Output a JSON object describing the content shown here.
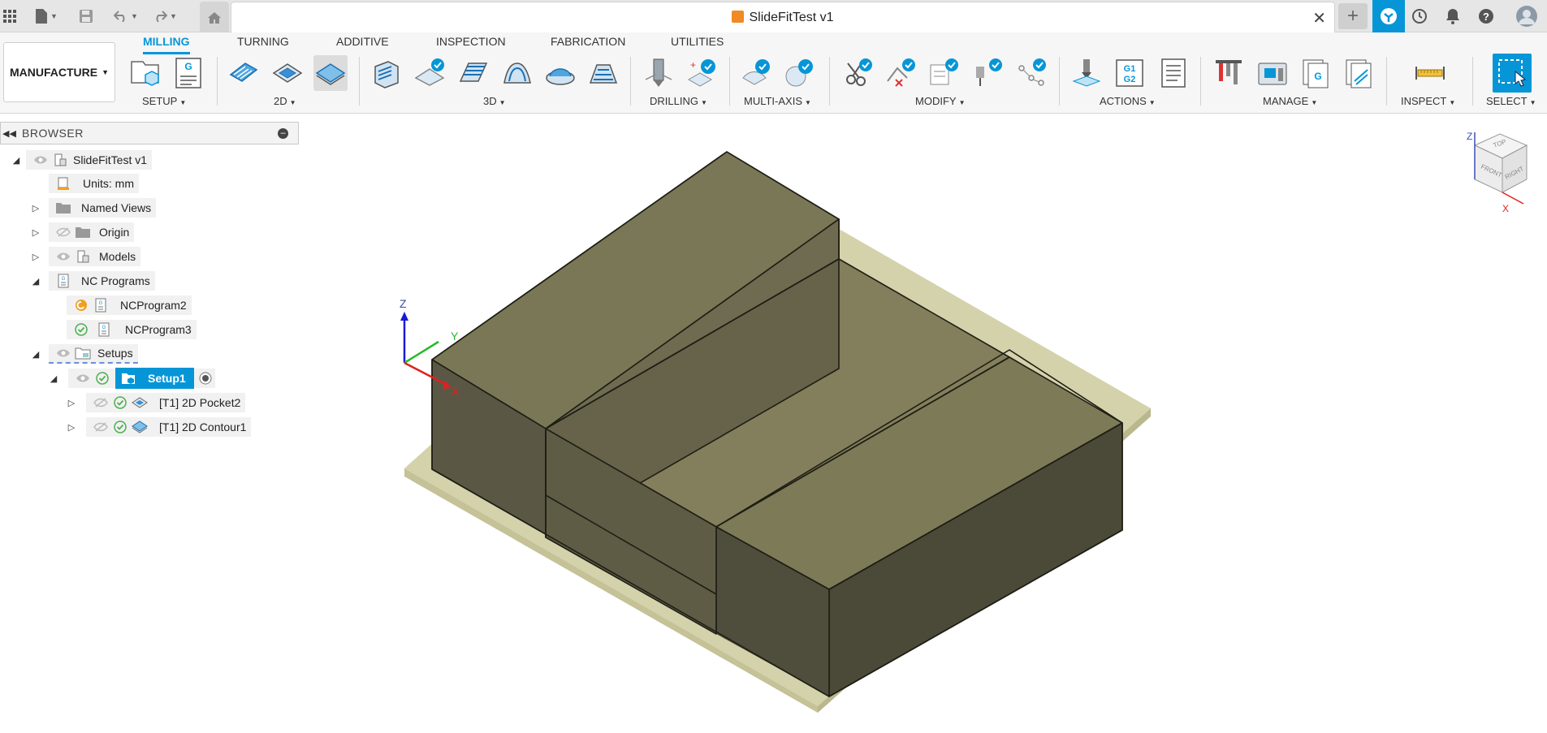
{
  "titlebar": {
    "document_title": "SlideFitTest v1",
    "icons": [
      "app-grid-icon",
      "file-icon",
      "save-icon",
      "undo-icon",
      "redo-icon",
      "home-icon",
      "close-icon",
      "plus-icon",
      "job-status-icon",
      "clock-icon",
      "bell-icon",
      "help-icon",
      "user-avatar-icon"
    ]
  },
  "toolbar": {
    "workspace": "MANUFACTURE",
    "tabs": [
      "MILLING",
      "TURNING",
      "ADDITIVE",
      "INSPECTION",
      "FABRICATION",
      "UTILITIES"
    ],
    "active_tab": "MILLING",
    "groups": [
      "SETUP",
      "2D",
      "3D",
      "DRILLING",
      "MULTI-AXIS",
      "MODIFY",
      "ACTIONS",
      "MANAGE",
      "INSPECT",
      "SELECT"
    ]
  },
  "browser": {
    "title": "BROWSER",
    "items": {
      "root": "SlideFitTest v1",
      "units": "Units: mm",
      "named_views": "Named Views",
      "origin": "Origin",
      "models": "Models",
      "nc_programs": "NC Programs",
      "nc_program2": "NCProgram2",
      "nc_program3": "NCProgram3",
      "setups": "Setups",
      "setup1": "Setup1",
      "op1": "[T1] 2D Pocket2",
      "op2": "[T1] 2D Contour1"
    }
  },
  "viewport": {
    "triad": {
      "z": "Z",
      "y": "Y",
      "x": "X"
    },
    "viewcube": {
      "top": "TOP",
      "front": "FRONT",
      "right": "RIGHT",
      "z": "Z",
      "x": "X"
    },
    "colors": {
      "stock": "#c9c79a",
      "part_top": "#7d7a58",
      "part_side": "#4f4d3c",
      "accent": "#0696d7"
    }
  }
}
